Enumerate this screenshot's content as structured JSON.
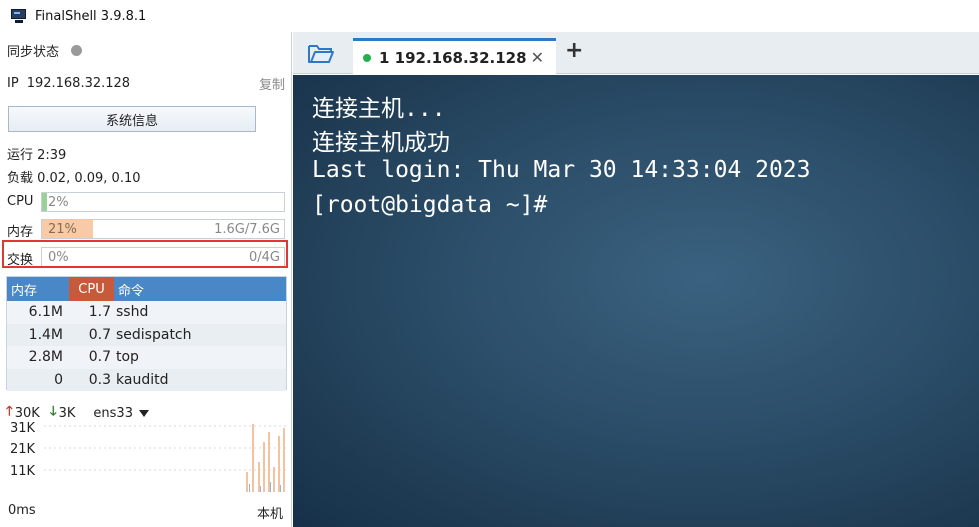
{
  "app": {
    "title": "FinalShell 3.9.8.1"
  },
  "sidebar": {
    "sync_label": "同步状态",
    "ip_label": "IP",
    "ip_value": "192.168.32.128",
    "copy_label": "复制",
    "sysinfo_button": "系统信息",
    "uptime": "运行 2:39",
    "load": "负载 0.02, 0.09, 0.10",
    "cpu": {
      "label": "CPU",
      "percent_text": "2%",
      "fraction": 0.02
    },
    "memory": {
      "label": "内存",
      "percent_text": "21%",
      "usage": "1.6G/7.6G",
      "fraction": 0.21
    },
    "swap": {
      "label": "交换",
      "percent_text": "0%",
      "usage": "0/4G",
      "fraction": 0.0
    }
  },
  "process_table": {
    "headers": [
      "内存",
      "CPU",
      "命令"
    ],
    "rows": [
      {
        "mem": "6.1M",
        "cpu": "1.7",
        "cmd": "sshd"
      },
      {
        "mem": "1.4M",
        "cpu": "0.7",
        "cmd": "sedispatch"
      },
      {
        "mem": "2.8M",
        "cpu": "0.7",
        "cmd": "top"
      },
      {
        "mem": "0",
        "cpu": "0.3",
        "cmd": "kauditd"
      }
    ]
  },
  "network": {
    "upload": "30K",
    "download": "3K",
    "interface": "ens33",
    "y_labels": [
      "31K",
      "21K",
      "11K"
    ],
    "latency": "0ms",
    "host": "本机"
  },
  "tabs": [
    {
      "label": "1 192.168.32.128",
      "status_color": "#22b14c"
    }
  ],
  "terminal": {
    "lines": [
      "连接主机...",
      "连接主机成功",
      "Last login: Thu Mar 30 14:33:04 2023",
      "[root@bigdata ~]#"
    ]
  },
  "colors": {
    "accent": "#2f78c4",
    "memory_fill": "#f7cba8",
    "table_header": "#4a87c7",
    "cpu_header": "#c85a3c"
  }
}
